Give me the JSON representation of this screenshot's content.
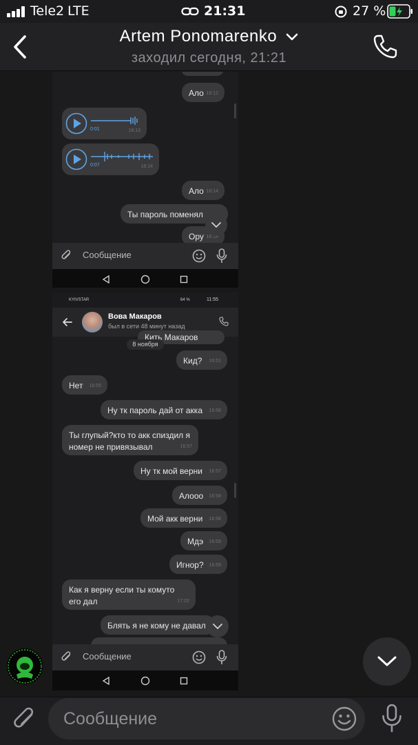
{
  "status_bar": {
    "carrier": "Tele2",
    "network": "LTE",
    "time": "21:31",
    "battery": "27 %"
  },
  "header": {
    "title": "Artem Ponomarenko",
    "subtitle": "заходил сегодня, 21:21"
  },
  "shot1": {
    "messages": [
      {
        "text": "Ало",
        "time": "18:12"
      },
      {
        "text": "Ало",
        "time": "18:14"
      },
      {
        "text": "Ты пароль поменял",
        "time": ""
      },
      {
        "text": "Ору",
        "time": "18:14"
      }
    ],
    "voice": [
      {
        "duration": "0:01",
        "time": "18:13"
      },
      {
        "duration": "0:07",
        "time": "18:14"
      }
    ],
    "input_placeholder": "Сообщение"
  },
  "shot2": {
    "status": {
      "carrier": "KYIVSTAR",
      "battery": "64 %",
      "time": "11:55"
    },
    "contact": {
      "name": "Вова Макаров",
      "seen": "был в сети 48 минут назад"
    },
    "cut_message": "Кить Макаров",
    "date_chip": "8 ноября",
    "messages": [
      {
        "text": "Кид?",
        "time": "16:51"
      },
      {
        "text": "Нет",
        "time": "16:55"
      },
      {
        "text": "Ну тк пароль дай от акка",
        "time": "16:56"
      },
      {
        "text": "Ты глупый?кто то акк спиздил я номер не привязывал",
        "time": "16:57"
      },
      {
        "text": "Ну тк мой верни",
        "time": "16:57"
      },
      {
        "text": "Алооо",
        "time": "16:58"
      },
      {
        "text": "Мой акк верни",
        "time": "16:58"
      },
      {
        "text": "Мдэ",
        "time": "16:59"
      },
      {
        "text": "Игнор?",
        "time": "16:59"
      },
      {
        "text": "Как я верну если ты комуто его дал",
        "time": "17:02"
      },
      {
        "text": "Блять я не кому не давал",
        "time": ""
      }
    ],
    "input_placeholder": "Сообщение"
  },
  "input": {
    "placeholder": "Сообщение"
  },
  "colors": {
    "accent": "#5ea3e8",
    "bubble": "#3a3a3c",
    "background": "#181818"
  }
}
